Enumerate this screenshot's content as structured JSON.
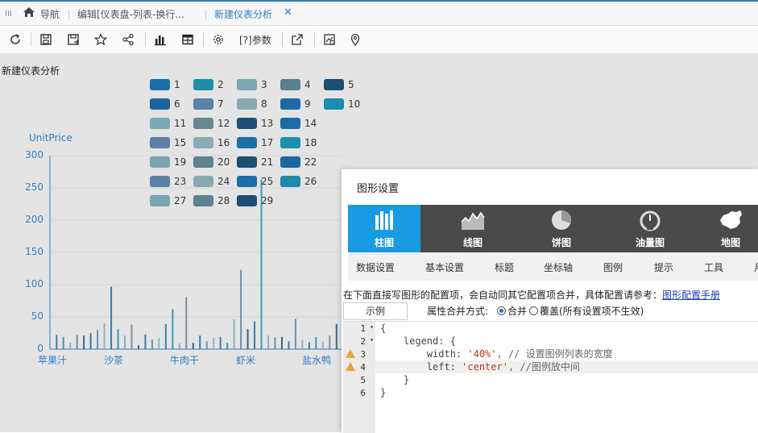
{
  "tabs": {
    "menu_glyph": "III",
    "nav_label": "导航",
    "edit_tab": "编辑[仪表盘-列表-换行...",
    "active_tab": "新建仪表分析",
    "close_glyph": "✕"
  },
  "toolbar": {
    "params_label": "参数",
    "params_icon_text": "[?]"
  },
  "page_title": "新建仪表分析",
  "chart_data": {
    "type": "bar",
    "ylabel": "UnitPrice",
    "ylim": [
      0,
      300
    ],
    "yticks": [
      "0",
      "50",
      "100",
      "150",
      "200",
      "250",
      "300"
    ],
    "xtick_labels": [
      "苹果汁",
      "沙茶",
      "牛肉干",
      "虾米",
      "盐水鸭"
    ],
    "values": [
      22,
      19,
      10,
      22,
      21,
      25,
      30,
      40,
      97,
      31,
      21,
      38,
      6,
      23,
      15,
      17,
      39,
      62,
      9,
      81,
      10,
      21,
      12,
      18,
      19,
      10,
      46,
      123,
      31,
      43,
      263,
      21,
      18,
      19,
      12,
      47,
      14,
      11,
      19,
      12,
      21,
      39
    ],
    "legend": [
      "1",
      "2",
      "3",
      "4",
      "5",
      "6",
      "7",
      "8",
      "9",
      "10",
      "11",
      "12",
      "13",
      "14",
      "15",
      "16",
      "17",
      "18",
      "19",
      "20",
      "21",
      "22",
      "23",
      "24",
      "25",
      "26",
      "27",
      "28",
      "29"
    ],
    "legend_colors": [
      "#1a6fa8",
      "#1d8fa8",
      "#7aa7b0",
      "#5c7f8c",
      "#1c4f72",
      "#1a65a0",
      "#5a82a8",
      "#88a8b0",
      "#1b6aa6",
      "#1a8cb0",
      "#7aa8b4",
      "#6a8890",
      "#1d4f78",
      "#1a6ca6",
      "#5a82a6",
      "#8aaab4",
      "#1c70a8",
      "#1d8eac",
      "#7aa4ae",
      "#5e8290",
      "#1c4f74",
      "#1a68a2",
      "#5a80a6",
      "#8aa8b2",
      "#1b6ea8",
      "#1d8ba8",
      "#7aa6b0",
      "#5f8190",
      "#1e4d74"
    ]
  },
  "dialog": {
    "title": "图形设置",
    "types": [
      {
        "label": "柱图",
        "icon": "bar-chart-icon"
      },
      {
        "label": "线图",
        "icon": "area-chart-icon"
      },
      {
        "label": "饼图",
        "icon": "pie-chart-icon"
      },
      {
        "label": "油量图",
        "icon": "gauge-icon"
      },
      {
        "label": "地图",
        "icon": "map-china-icon"
      }
    ],
    "subtabs": [
      "数据设置",
      "基本设置",
      "标题",
      "坐标轴",
      "图例",
      "提示",
      "工具",
      "月"
    ],
    "hint_text": "在下面直接写图形的配置项，会自动同其它配置项合并，具体配置请参考：",
    "hint_link": "图形配置手册",
    "example_btn": "示例",
    "merge_label": "属性合并方式:",
    "merge_option": "合并",
    "override_option": "覆盖(所有设置项不生效)",
    "code_lines": [
      {
        "num": "1",
        "fold": true,
        "warn": false
      },
      {
        "num": "2",
        "fold": true,
        "warn": false
      },
      {
        "num": "3",
        "fold": false,
        "warn": true
      },
      {
        "num": "4",
        "fold": false,
        "warn": true
      },
      {
        "num": "5",
        "fold": false,
        "warn": false
      },
      {
        "num": "6",
        "fold": false,
        "warn": false
      }
    ],
    "code": {
      "l1": "{",
      "l2": "    legend: {",
      "l3_pre": "        width: ",
      "l3_str": "'40%'",
      "l3_cmt": ", // 设置图例列表的宽度",
      "l4_pre": "        left: ",
      "l4_str": "'center'",
      "l4_cmt": ", //图例放中间",
      "l5": "    }",
      "l6": "}"
    }
  }
}
